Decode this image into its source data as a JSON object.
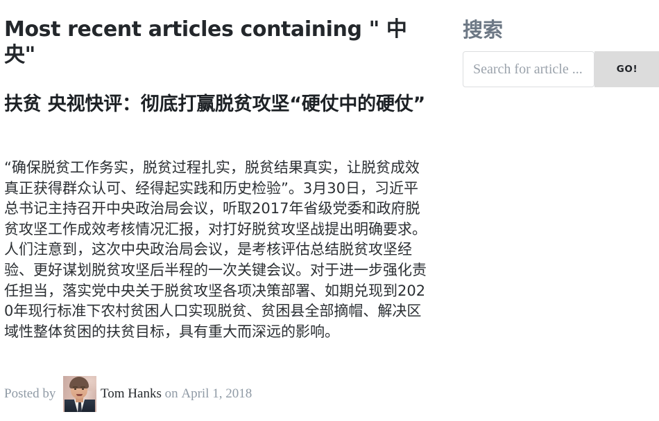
{
  "archive": {
    "title": "Most recent articles containing \" 中央\""
  },
  "post": {
    "title": "扶贫 央视快评：彻底打赢脱贫攻坚“硬仗中的硬仗”",
    "body": "“确保脱贫工作务实，脱贫过程扎实，脱贫结果真实，让脱贫成效真正获得群众认可、经得起实践和历史检验”。3月30日，习近平总书记主持召开中央政治局会议，听取2017年省级党委和政府脱贫攻坚工作成效考核情况汇报，对打好脱贫攻坚战提出明确要求。 人们注意到，这次中央政治局会议，是考核评估总结脱贫攻坚经验、更好谋划脱贫攻坚后半程的一次关键会议。对于进一步强化责任担当，落实党中央关于脱贫攻坚各项决策部署、如期兑现到2020年现行标准下农村贫困人口实现脱贫、贫困县全部摘帽、解决区域性整体贫困的扶贫目标，具有重大而深远的影响。",
    "byline": {
      "prefix": "Posted by",
      "author": "Tom Hanks",
      "connector": "on",
      "date": "April 1, 2018",
      "avatar_alt": "author-avatar"
    }
  },
  "sidebar": {
    "search_widget": {
      "title": "搜索",
      "placeholder": "Search for article ...",
      "value": "",
      "submit_label": "GO!"
    }
  },
  "colors": {
    "heading": "#23272b",
    "body_text": "#2b2f33",
    "widget_title": "#6d7885",
    "muted_text": "#8f9aa5",
    "button_bg": "#dcdcdc",
    "input_border": "#dcdddf",
    "page_bg": "#ffffff"
  }
}
